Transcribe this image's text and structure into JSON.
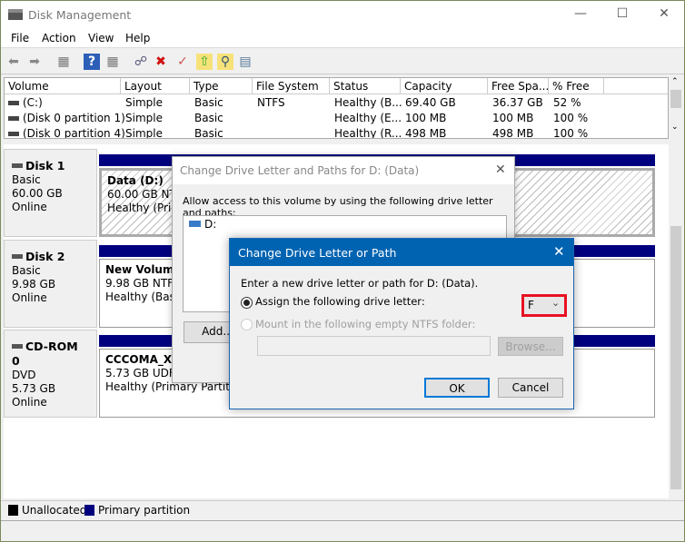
{
  "window": {
    "title": "Disk Management",
    "icon": "disk-management-icon"
  },
  "menu": [
    "File",
    "Action",
    "View",
    "Help"
  ],
  "toolbar": [
    "back-icon",
    "forward-icon",
    "console-tree-icon",
    "help-icon",
    "action-pane-icon",
    "connect-icon",
    "delete-icon",
    "properties-icon",
    "new-folder-icon",
    "search-folder-icon",
    "settings-list-icon"
  ],
  "volumes": {
    "headers": [
      "Volume",
      "Layout",
      "Type",
      "File System",
      "Status",
      "Capacity",
      "Free Spa...",
      "% Free"
    ],
    "rows": [
      [
        "(C:)",
        "Simple",
        "Basic",
        "NTFS",
        "Healthy (B...",
        "69.40 GB",
        "36.37 GB",
        "52 %"
      ],
      [
        "(Disk 0 partition 1)",
        "Simple",
        "Basic",
        "",
        "Healthy (E...",
        "100 MB",
        "100 MB",
        "100 %"
      ],
      [
        "(Disk 0 partition 4)",
        "Simple",
        "Basic",
        "",
        "Healthy (R...",
        "498 MB",
        "498 MB",
        "100 %"
      ]
    ]
  },
  "disks": [
    {
      "name": "Disk 1",
      "type": "Basic",
      "size": "60.00 GB",
      "state": "Online",
      "part_name": "Data  (D:)",
      "part_size": "60.00 GB NTFS",
      "part_status": "Healthy (Prim"
    },
    {
      "name": "Disk 2",
      "type": "Basic",
      "size": "9.98 GB",
      "state": "Online",
      "part_name": "New Volume",
      "part_size": "9.98 GB NTFS",
      "part_status": "Healthy (Basic"
    },
    {
      "name": "CD-ROM 0",
      "type": "DVD",
      "size": "5.73 GB",
      "state": "Online",
      "part_name": "CCCOMA_X64",
      "part_size": "5.73 GB UDF",
      "part_status": "Healthy (Primary Partition)"
    }
  ],
  "legend": [
    {
      "label": "Unallocated",
      "color": "#000000"
    },
    {
      "label": "Primary partition",
      "color": "#00007f"
    }
  ],
  "dialog1": {
    "title": "Change Drive Letter and Paths for D: (Data)",
    "text": "Allow access to this volume by using the following drive letter and paths:",
    "item": "D:",
    "add": "Add..."
  },
  "dialog2": {
    "title": "Change Drive Letter or Path",
    "text": "Enter a new drive letter or path for D: (Data).",
    "assign": "Assign the following drive letter:",
    "assign_selected": true,
    "letter": "F",
    "mount": "Mount in the following empty NTFS folder:",
    "mount_path": "",
    "browse": "Browse...",
    "ok": "OK",
    "cancel": "Cancel",
    "accent": "#0063b1",
    "highlight": "#e81123"
  }
}
